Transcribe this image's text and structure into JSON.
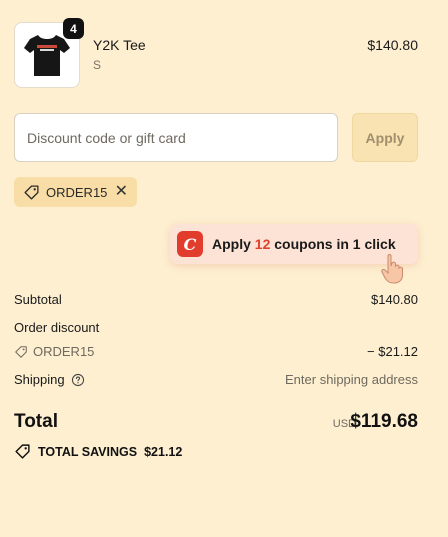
{
  "product": {
    "quantity": "4",
    "name": "Y2K Tee",
    "variant": "S",
    "price": "$140.80"
  },
  "discount": {
    "placeholder": "Discount code or gift card",
    "value": "",
    "apply_label": "Apply",
    "applied_code": "ORDER15"
  },
  "coupon_banner": {
    "prefix": "Apply ",
    "count": "12",
    "suffix": " coupons in 1 click",
    "logo_letter": "C",
    "brand_color": "#e23c2c"
  },
  "summary": {
    "subtotal_label": "Subtotal",
    "subtotal_value": "$140.80",
    "order_discount_label": "Order discount",
    "order_discount_code": "ORDER15",
    "order_discount_value": "− $21.12",
    "shipping_label": "Shipping",
    "shipping_value": "Enter shipping address"
  },
  "total": {
    "label": "Total",
    "currency": "USD",
    "value": "$119.68"
  },
  "savings": {
    "label": "TOTAL SAVINGS",
    "value": "$21.12"
  },
  "icons": [
    "tshirt-image",
    "tag-icon",
    "close-icon",
    "coupon-logo-icon",
    "pointer-hand-icon",
    "help-circle-icon",
    "tag-icon"
  ]
}
